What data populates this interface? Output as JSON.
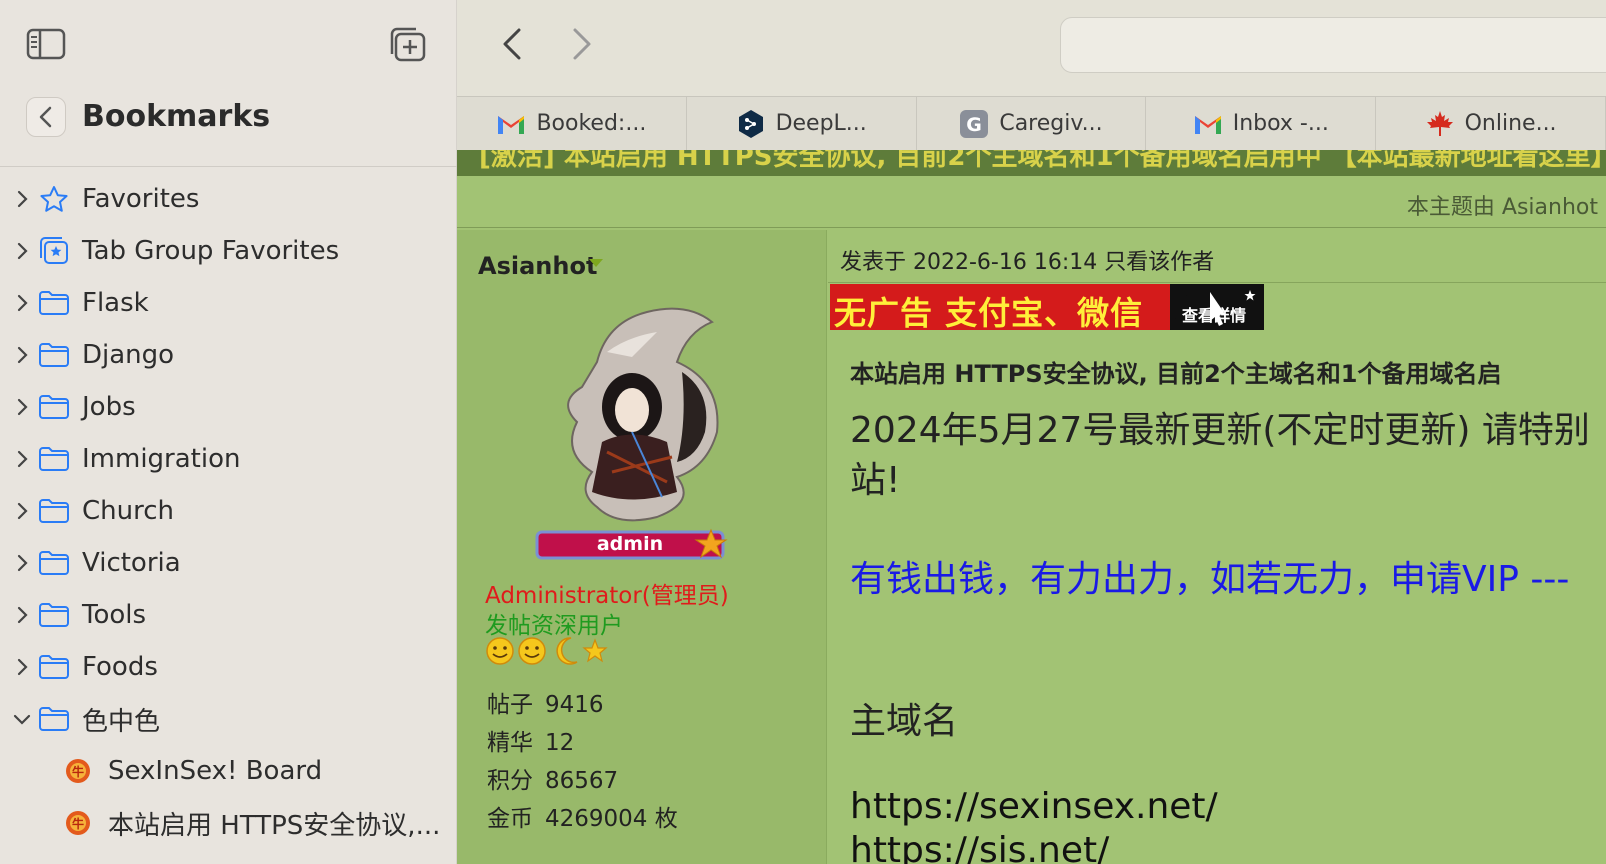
{
  "sidebar": {
    "title": "Bookmarks",
    "items": [
      {
        "label": "Favorites",
        "icon": "star-icon"
      },
      {
        "label": "Tab Group Favorites",
        "icon": "tab-group-star-icon"
      },
      {
        "label": "Flask",
        "icon": "folder-icon"
      },
      {
        "label": "Django",
        "icon": "folder-icon"
      },
      {
        "label": "Jobs",
        "icon": "folder-icon"
      },
      {
        "label": "Immigration",
        "icon": "folder-icon"
      },
      {
        "label": "Church",
        "icon": "folder-icon"
      },
      {
        "label": "Victoria",
        "icon": "folder-icon"
      },
      {
        "label": "Tools",
        "icon": "folder-icon"
      },
      {
        "label": "Foods",
        "icon": "folder-icon"
      },
      {
        "label": "色中色",
        "icon": "folder-icon",
        "expanded": true
      }
    ],
    "sub_items": [
      {
        "label": "SexInSex! Board",
        "icon": "site-favicon"
      },
      {
        "label": "本站启用 HTTPS安全协议,..."
      }
    ]
  },
  "tabs": [
    {
      "label": "Booked:...",
      "icon": "gmail-icon"
    },
    {
      "label": "DeepL...",
      "icon": "deepl-icon"
    },
    {
      "label": "Caregiv...",
      "icon": "g-icon"
    },
    {
      "label": "Inbox -...",
      "icon": "gmail-icon"
    },
    {
      "label": "Online...",
      "icon": "maple-leaf-icon"
    }
  ],
  "page": {
    "banner_strip": "[激活] 本站启用 HTTPS安全协议, 目前2个主域名和1个备用域名启用中 【本站最新地址看这里】",
    "topic_by": "本主题由 Asianhot",
    "author": {
      "name": "Asianhot",
      "badge": "admin",
      "role": "Administrator(管理员)",
      "rank": "发帖资深用户",
      "stats": [
        {
          "label": "帖子",
          "value": "9416"
        },
        {
          "label": "精华",
          "value": "12"
        },
        {
          "label": "积分",
          "value": "86567"
        },
        {
          "label": "金币",
          "value": "4269004 枚"
        }
      ]
    },
    "post": {
      "meta": "发表于 2022-6-16 16:14  只看该作者",
      "ad_text": "无广告 支付宝、微信",
      "ad_detail": "查看詳情",
      "heading": "本站启用 HTTPS安全协议, 目前2个主域名和1个备用域名启",
      "update_line": "2024年5月27号最新更新(不定时更新) 请特别",
      "update_line_2": "站!",
      "blue_line": "有钱出钱，有力出力，如若无力，申请VIP ---",
      "domain_label": "主域名",
      "url_1": "https://sexinsex.net/",
      "url_2": "https://sis.net/"
    }
  },
  "colors": {
    "page_bg": "#a2c374",
    "author_bg": "#98b96a",
    "banner_strip": "#5e7c3a",
    "role_red": "#e01b1b",
    "rank_green": "#1f9b1f",
    "link_blue": "#1a1ae6"
  }
}
